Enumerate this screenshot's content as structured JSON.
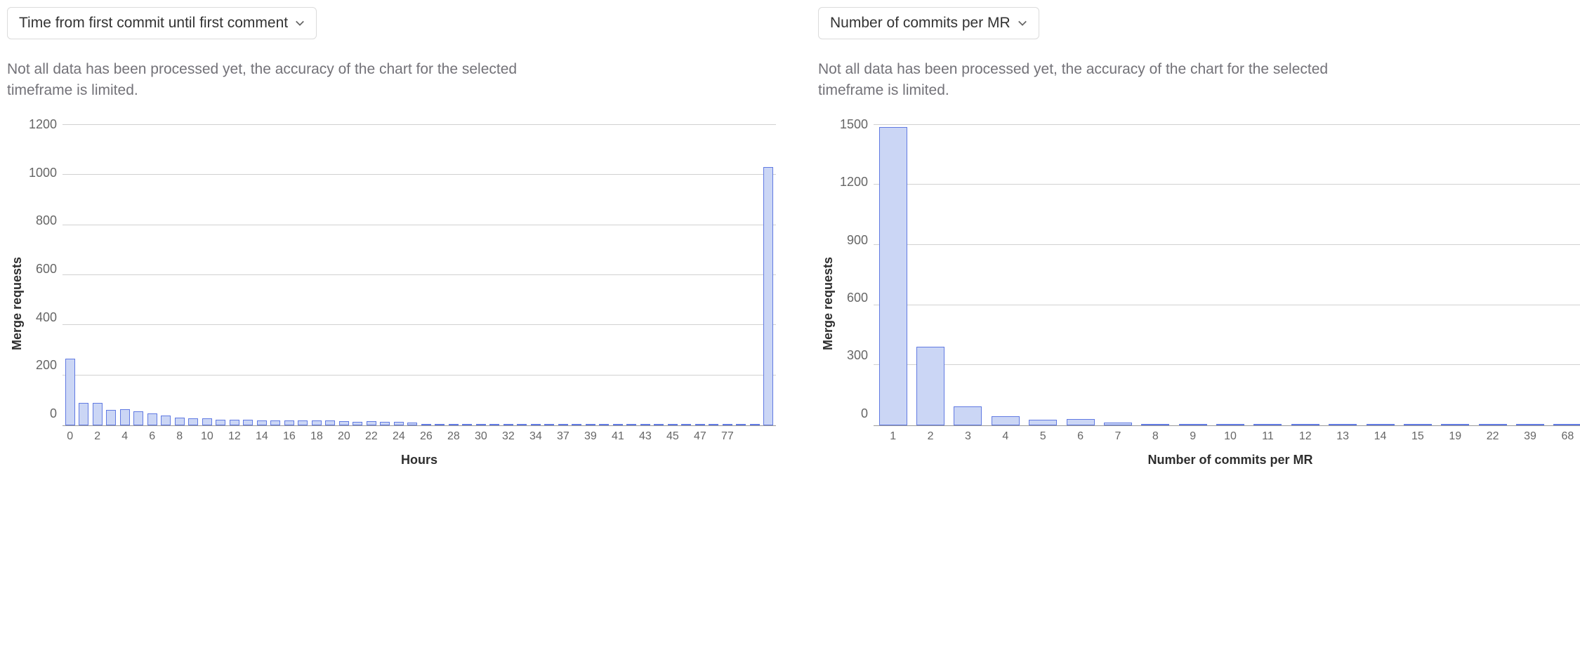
{
  "warning_text": "Not all data has been processed yet, the accuracy of the chart for the selected timeframe is limited.",
  "left": {
    "dropdown_label": "Time from first commit until first comment",
    "ylabel": "Merge requests",
    "xlabel": "Hours"
  },
  "right": {
    "dropdown_label": "Number of commits per MR",
    "ylabel": "Merge requests",
    "xlabel": "Number of commits per MR"
  },
  "chart_data": [
    {
      "type": "bar",
      "title": "Time from first commit until first comment",
      "xlabel": "Hours",
      "ylabel": "Merge requests",
      "ylim": [
        0,
        1200
      ],
      "y_ticks": [
        0,
        200,
        400,
        600,
        800,
        1000,
        1200
      ],
      "categories": [
        "0",
        "1",
        "2",
        "3",
        "4",
        "5",
        "6",
        "7",
        "8",
        "9",
        "10",
        "11",
        "12",
        "13",
        "14",
        "15",
        "16",
        "17",
        "18",
        "19",
        "20",
        "21",
        "22",
        "23",
        "24",
        "25",
        "26",
        "27",
        "28",
        "29",
        "30",
        "31",
        "32",
        "33",
        "34",
        "35",
        "37",
        "38",
        "39",
        "40",
        "41",
        "42",
        "43",
        "44",
        "45",
        "46",
        "47",
        "48",
        "77",
        "",
        "",
        ""
      ],
      "x_tick_every": 2,
      "values": [
        265,
        88,
        90,
        60,
        64,
        55,
        48,
        40,
        30,
        28,
        28,
        22,
        22,
        22,
        20,
        20,
        20,
        18,
        18,
        18,
        16,
        14,
        16,
        14,
        14,
        10,
        6,
        6,
        6,
        6,
        6,
        6,
        6,
        6,
        6,
        6,
        6,
        6,
        6,
        6,
        6,
        6,
        6,
        6,
        6,
        6,
        6,
        6,
        6,
        6,
        6,
        1030
      ]
    },
    {
      "type": "bar",
      "title": "Number of commits per MR",
      "xlabel": "Number of commits per MR",
      "ylabel": "Merge requests",
      "ylim": [
        0,
        1500
      ],
      "y_ticks": [
        0,
        300,
        600,
        900,
        1200,
        1500
      ],
      "categories": [
        "1",
        "2",
        "3",
        "4",
        "5",
        "6",
        "7",
        "8",
        "9",
        "10",
        "11",
        "12",
        "13",
        "14",
        "15",
        "19",
        "22",
        "39",
        "68"
      ],
      "x_tick_every": 1,
      "values": [
        1485,
        390,
        95,
        45,
        28,
        30,
        12,
        6,
        6,
        6,
        6,
        6,
        6,
        6,
        6,
        6,
        6,
        6,
        6
      ]
    }
  ]
}
